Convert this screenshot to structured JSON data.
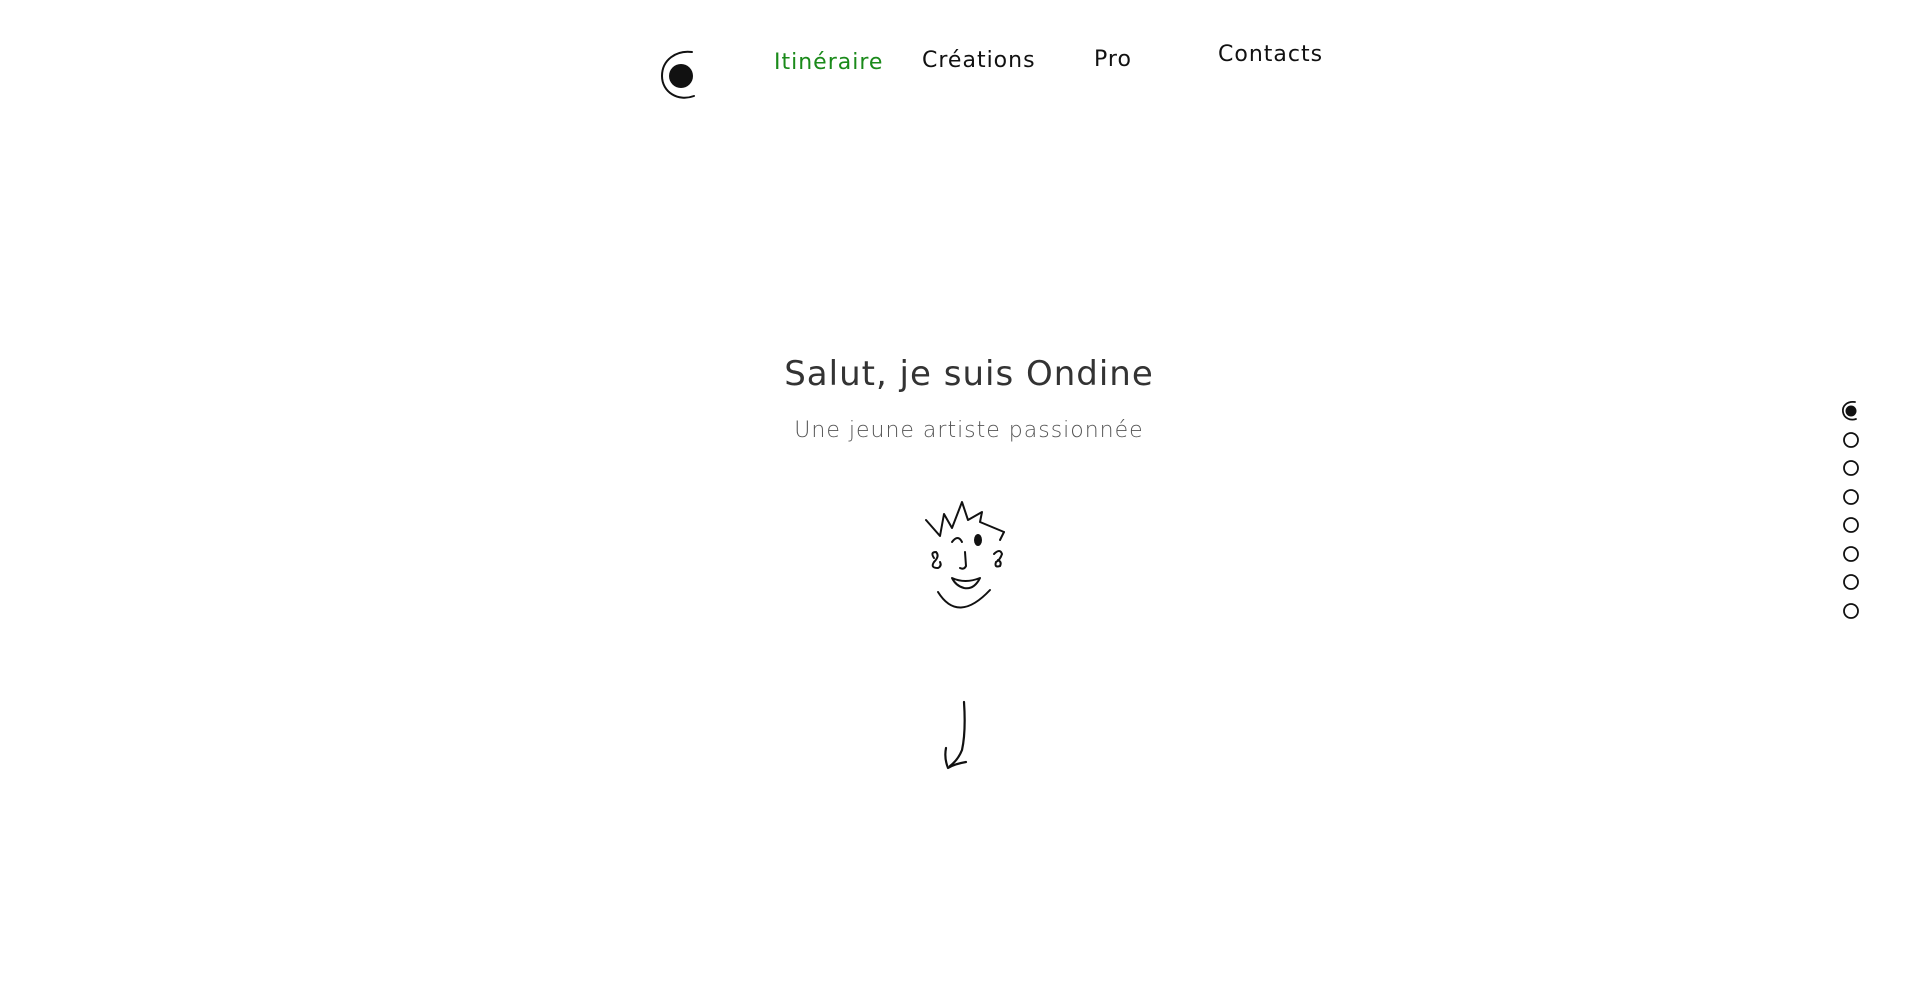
{
  "nav": {
    "logo_icon": "circle-dot-logo-icon",
    "items": [
      {
        "label": "Itinéraire",
        "active": true
      },
      {
        "label": "Créations",
        "active": false
      },
      {
        "label": "Pro",
        "active": false
      },
      {
        "label": "Contacts",
        "active": false
      }
    ],
    "active_color": "#1a8a1a"
  },
  "hero": {
    "title": "Salut, je suis Ondine",
    "subtitle": "Une jeune artiste passionnée",
    "illustration_icon": "smiling-face-doodle-icon",
    "scroll_icon": "arrow-down-icon"
  },
  "side_nav": {
    "dot_count": 8,
    "active_index": 0
  }
}
